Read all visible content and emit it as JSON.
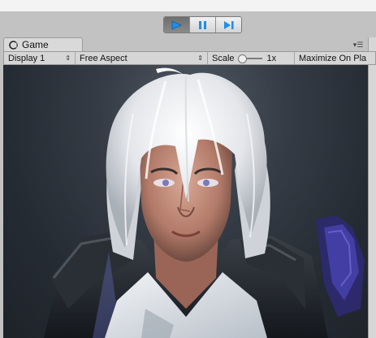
{
  "toolbar": {
    "buttons": [
      {
        "name": "play",
        "icon": "play-icon",
        "active": true
      },
      {
        "name": "pause",
        "icon": "pause-icon",
        "active": false
      },
      {
        "name": "step",
        "icon": "step-icon",
        "active": false
      }
    ]
  },
  "tab": {
    "icon": "unity-game-view-icon",
    "label": "Game",
    "menu_icon": "tab-menu-icon"
  },
  "gamebar": {
    "display": "Display 1",
    "aspect": "Free Aspect",
    "scale_label": "Scale",
    "scale_value": "1x",
    "maximize": "Maximize On Pla"
  },
  "viewport": {
    "content": "game-render-character-portrait"
  },
  "colors": {
    "play_accent": "#1e8fe8",
    "editor_bg": "#c2c2c2",
    "viewport_bg": "#2a3038"
  }
}
